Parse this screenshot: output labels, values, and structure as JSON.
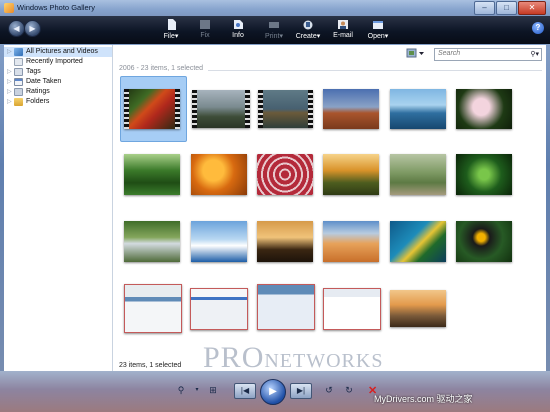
{
  "window": {
    "title": "Windows Photo Gallery"
  },
  "toolbar": {
    "items": [
      {
        "label": "File",
        "dropdown": true,
        "icon": "file-icon"
      },
      {
        "label": "Fix",
        "dropdown": false,
        "disabled": true,
        "icon": "fix-icon"
      },
      {
        "label": "Info",
        "dropdown": false,
        "icon": "info-icon"
      },
      {
        "label": "Print",
        "dropdown": true,
        "disabled": true,
        "icon": "print-icon"
      },
      {
        "label": "Create",
        "dropdown": true,
        "icon": "create-icon"
      },
      {
        "label": "E-mail",
        "dropdown": false,
        "icon": "email-icon"
      },
      {
        "label": "Open",
        "dropdown": true,
        "icon": "open-icon"
      }
    ],
    "dropdown_glyph": "▾",
    "help": "?"
  },
  "sidebar": {
    "items": [
      {
        "label": "All Pictures and Videos",
        "selected": true,
        "expandable": true,
        "icon": "pictures-icon"
      },
      {
        "label": "Recently Imported",
        "selected": false,
        "expandable": false,
        "icon": "import-icon"
      },
      {
        "label": "Tags",
        "selected": false,
        "expandable": true,
        "icon": "tag-icon"
      },
      {
        "label": "Date Taken",
        "selected": false,
        "expandable": true,
        "icon": "calendar-icon"
      },
      {
        "label": "Ratings",
        "selected": false,
        "expandable": true,
        "icon": "star-icon"
      },
      {
        "label": "Folders",
        "selected": false,
        "expandable": true,
        "icon": "folder-icon"
      }
    ]
  },
  "search": {
    "placeholder": "Search"
  },
  "gallery": {
    "group_header": "2006 - 23 items, 1 selected",
    "status": "23 items, 1 selected"
  },
  "watermark": {
    "first": "PRO",
    "second": "NETWORKS"
  },
  "bottom": {
    "site_text": "MyDrivers.com 驱动之家"
  },
  "colors": {
    "selection": "#a6cdf5",
    "toolbar": "#0d1525",
    "delete": "#d72020"
  }
}
